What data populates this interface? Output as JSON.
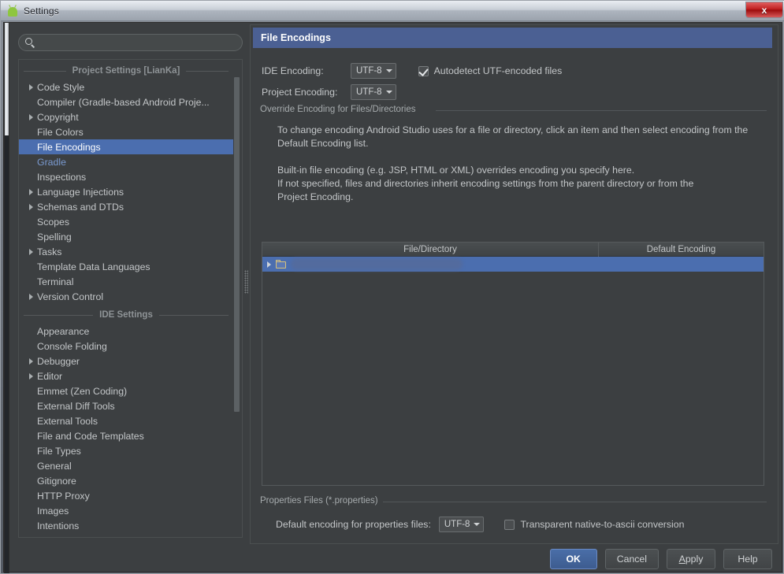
{
  "window": {
    "title": "Settings",
    "app_icon": "android-icon",
    "close_label": "x"
  },
  "search": {
    "value": "",
    "placeholder": "",
    "icon": "search-icon"
  },
  "sidebar": {
    "groups": [
      {
        "header": "Project Settings [LianKa]",
        "items": [
          {
            "label": "Code Style",
            "expandable": true,
            "selected": false,
            "accent": false
          },
          {
            "label": "Compiler (Gradle-based Android Proje...",
            "expandable": false,
            "selected": false,
            "accent": false
          },
          {
            "label": "Copyright",
            "expandable": true,
            "selected": false,
            "accent": false
          },
          {
            "label": "File Colors",
            "expandable": false,
            "selected": false,
            "accent": false
          },
          {
            "label": "File Encodings",
            "expandable": false,
            "selected": true,
            "accent": false
          },
          {
            "label": "Gradle",
            "expandable": false,
            "selected": false,
            "accent": true
          },
          {
            "label": "Inspections",
            "expandable": false,
            "selected": false,
            "accent": false
          },
          {
            "label": "Language Injections",
            "expandable": true,
            "selected": false,
            "accent": false
          },
          {
            "label": "Schemas and DTDs",
            "expandable": true,
            "selected": false,
            "accent": false
          },
          {
            "label": "Scopes",
            "expandable": false,
            "selected": false,
            "accent": false
          },
          {
            "label": "Spelling",
            "expandable": false,
            "selected": false,
            "accent": false
          },
          {
            "label": "Tasks",
            "expandable": true,
            "selected": false,
            "accent": false
          },
          {
            "label": "Template Data Languages",
            "expandable": false,
            "selected": false,
            "accent": false
          },
          {
            "label": "Terminal",
            "expandable": false,
            "selected": false,
            "accent": false
          },
          {
            "label": "Version Control",
            "expandable": true,
            "selected": false,
            "accent": false
          }
        ]
      },
      {
        "header": "IDE Settings",
        "items": [
          {
            "label": "Appearance",
            "expandable": false,
            "selected": false,
            "accent": false
          },
          {
            "label": "Console Folding",
            "expandable": false,
            "selected": false,
            "accent": false
          },
          {
            "label": "Debugger",
            "expandable": true,
            "selected": false,
            "accent": false
          },
          {
            "label": "Editor",
            "expandable": true,
            "selected": false,
            "accent": false
          },
          {
            "label": "Emmet (Zen Coding)",
            "expandable": false,
            "selected": false,
            "accent": false
          },
          {
            "label": "External Diff Tools",
            "expandable": false,
            "selected": false,
            "accent": false
          },
          {
            "label": "External Tools",
            "expandable": false,
            "selected": false,
            "accent": false
          },
          {
            "label": "File and Code Templates",
            "expandable": false,
            "selected": false,
            "accent": false
          },
          {
            "label": "File Types",
            "expandable": false,
            "selected": false,
            "accent": false
          },
          {
            "label": "General",
            "expandable": false,
            "selected": false,
            "accent": false
          },
          {
            "label": "Gitignore",
            "expandable": false,
            "selected": false,
            "accent": false
          },
          {
            "label": "HTTP Proxy",
            "expandable": false,
            "selected": false,
            "accent": false
          },
          {
            "label": "Images",
            "expandable": false,
            "selected": false,
            "accent": false
          },
          {
            "label": "Intentions",
            "expandable": false,
            "selected": false,
            "accent": false
          }
        ]
      }
    ]
  },
  "panel": {
    "title": "File Encodings",
    "ide_encoding_label": "IDE Encoding:",
    "ide_encoding_value": "UTF-8",
    "project_encoding_label": "Project Encoding:",
    "project_encoding_value": "UTF-8",
    "autodetect_label": "Autodetect UTF-encoded files",
    "autodetect_checked": true,
    "override_group_title": "Override Encoding for Files/Directories",
    "description_p1": "To change encoding Android Studio uses for a file or directory, click an item and then select encoding from the Default Encoding list.",
    "description_p2_line1": "Built-in file encoding (e.g. JSP, HTML or XML) overrides encoding you specify here.",
    "description_p2_line2": "If not specified, files and directories inherit encoding settings from the parent directory or from the",
    "description_p2_line3": "Project Encoding.",
    "table": {
      "columns": [
        "File/Directory",
        "Default Encoding"
      ],
      "rows": [
        {
          "file_directory": "",
          "default_encoding": "",
          "redacted": true,
          "expandable": true,
          "icon": "folder-icon",
          "selected": true
        }
      ]
    },
    "properties_group_title": "Properties Files (*.properties)",
    "properties_encoding_label": "Default encoding for properties files:",
    "properties_encoding_value": "UTF-8",
    "transparent_label": "Transparent native-to-ascii conversion",
    "transparent_checked": false
  },
  "buttons": {
    "ok": "OK",
    "cancel": "Cancel",
    "apply_prefix": "A",
    "apply_rest": "pply",
    "help": "Help"
  },
  "colors": {
    "selection": "#4b6eaf",
    "header": "#4b6093",
    "panel_bg": "#3c3f41",
    "text": "#c3c6c8",
    "accent_text": "#7a9ad0",
    "close_red": "#c02020"
  }
}
